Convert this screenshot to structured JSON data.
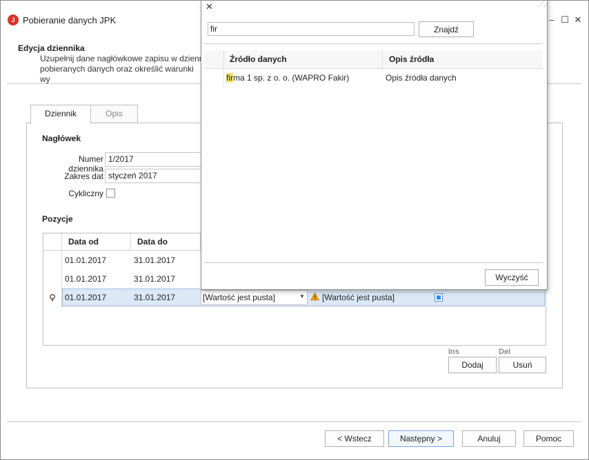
{
  "window": {
    "title": "Pobieranie danych JPK",
    "minimize": "–",
    "maximize": "☐",
    "close": "✕"
  },
  "header": {
    "title": "Edycja dziennika",
    "description": "Uzupełnij dane nagłówkowe zapisu w dzienn pobieranych danych oraz określić warunki wy"
  },
  "tabs": [
    {
      "label": "Dziennik",
      "active": true
    },
    {
      "label": "Opis",
      "active": false
    }
  ],
  "form": {
    "section_title": "Nagłówek",
    "numer_label": "Numer dziennika",
    "numer_value": "1/2017",
    "zakres_label": "Zakres dat",
    "zakres_value": "styczeń 2017",
    "cykliczny_label": "Cykliczny",
    "cykliczny_checked": false
  },
  "positions": {
    "title": "Pozycje",
    "columns": [
      "Data od",
      "Data do"
    ],
    "rows": [
      {
        "od": "01.01.2017",
        "do": "31.01.2017"
      },
      {
        "od": "01.01.2017",
        "do": "31.01.2017"
      },
      {
        "od": "01.01.2017",
        "do": "31.01.2017",
        "source": "[Wartość jest pusta]",
        "warning": "[Wartość jest pusta]",
        "checked": true
      }
    ],
    "ins_shortcut": "Ins",
    "del_shortcut": "Del",
    "add_label": "Dodaj",
    "remove_label": "Usuń"
  },
  "footer": {
    "back_label": "< Wstecz",
    "next_label": "Następny >",
    "cancel_label": "Anuluj",
    "help_label": "Pomoc"
  },
  "popup": {
    "close": "✕",
    "search_value": "fir",
    "search_button": "Znajdź",
    "columns": [
      "Źródło danych",
      "Opis źródła"
    ],
    "results": [
      {
        "source_highlight": "fir",
        "source_rest": "ma 1 sp. z o. o. (WAPRO Fakir)",
        "description": "Opis źródła danych"
      }
    ],
    "clear_button": "Wyczyść"
  },
  "colors": {
    "accent": "#d9352a",
    "selected_row": "#dbe8f5",
    "highlight": "#f5e36b",
    "warning": "#f0a500"
  }
}
